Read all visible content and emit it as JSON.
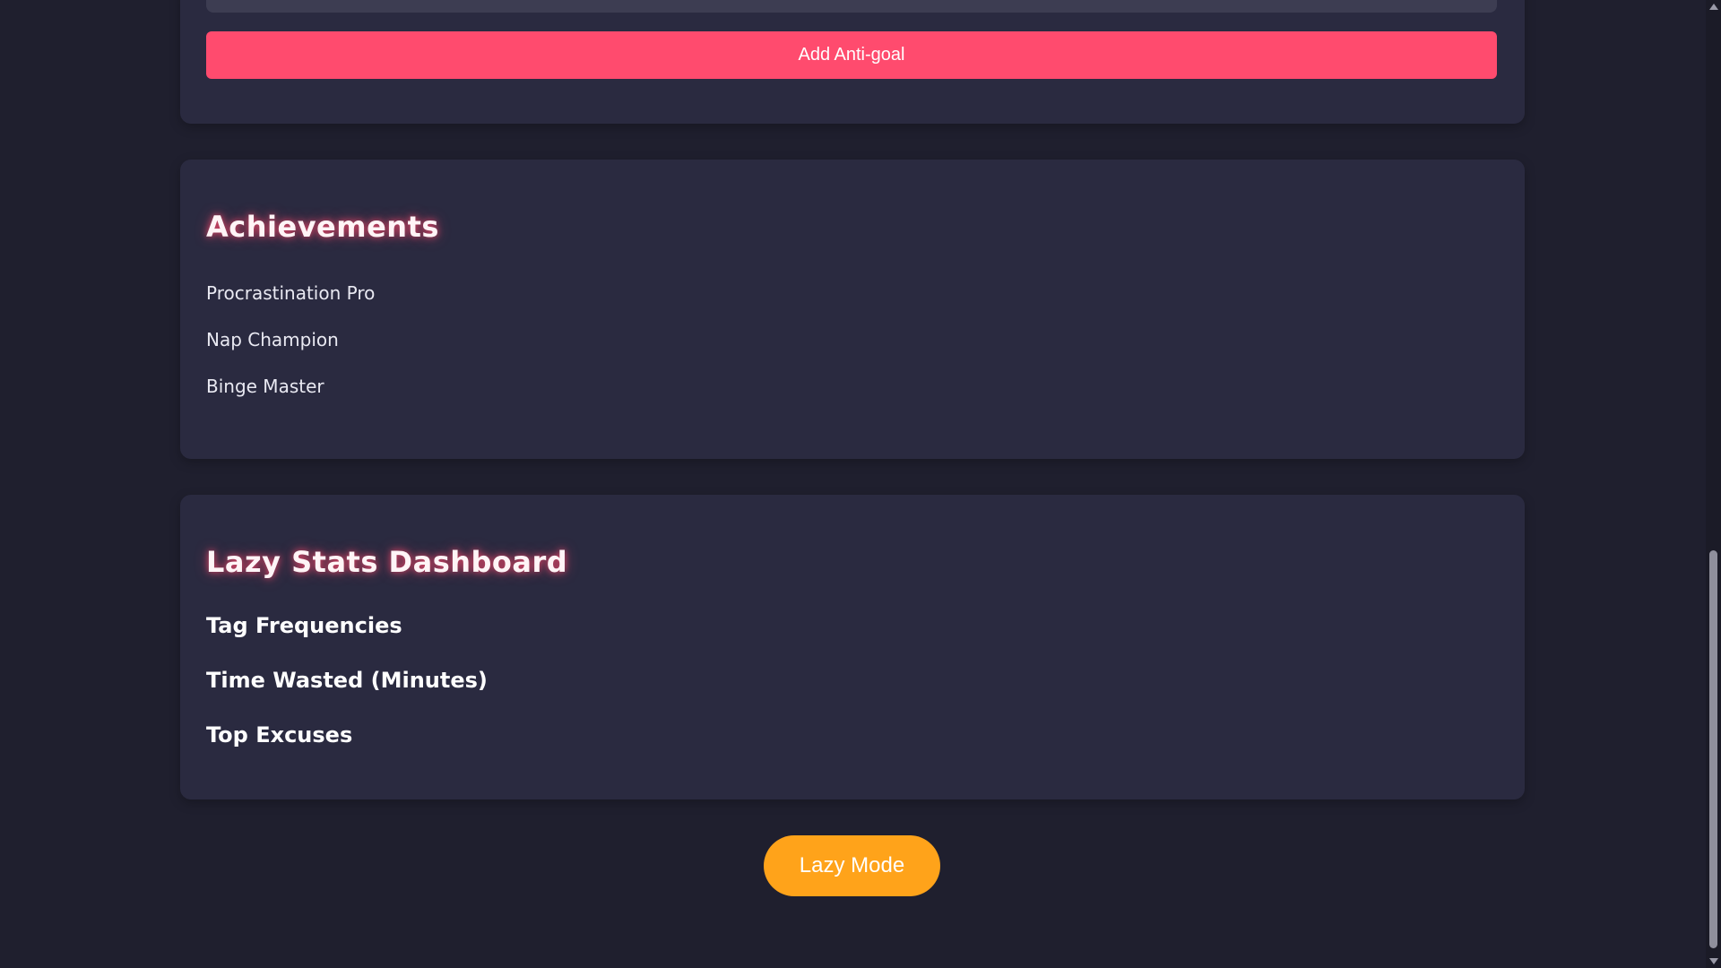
{
  "anti_goal_form": {
    "add_button_label": "Add Anti-goal"
  },
  "achievements": {
    "title": "Achievements",
    "items": [
      "Procrastination Pro",
      "Nap Champion",
      "Binge Master"
    ]
  },
  "stats_dashboard": {
    "title": "Lazy Stats Dashboard",
    "sections": [
      "Tag Frequencies",
      "Time Wasted (Minutes)",
      "Top Excuses"
    ]
  },
  "lazy_mode_button": {
    "label": "Lazy Mode"
  },
  "colors": {
    "background": "#1f1f2e",
    "card": "#2a2a40",
    "add_button": "#ff4b6e",
    "lazy_button": "#ffa31a",
    "title_glow": "#ff4b6e"
  }
}
